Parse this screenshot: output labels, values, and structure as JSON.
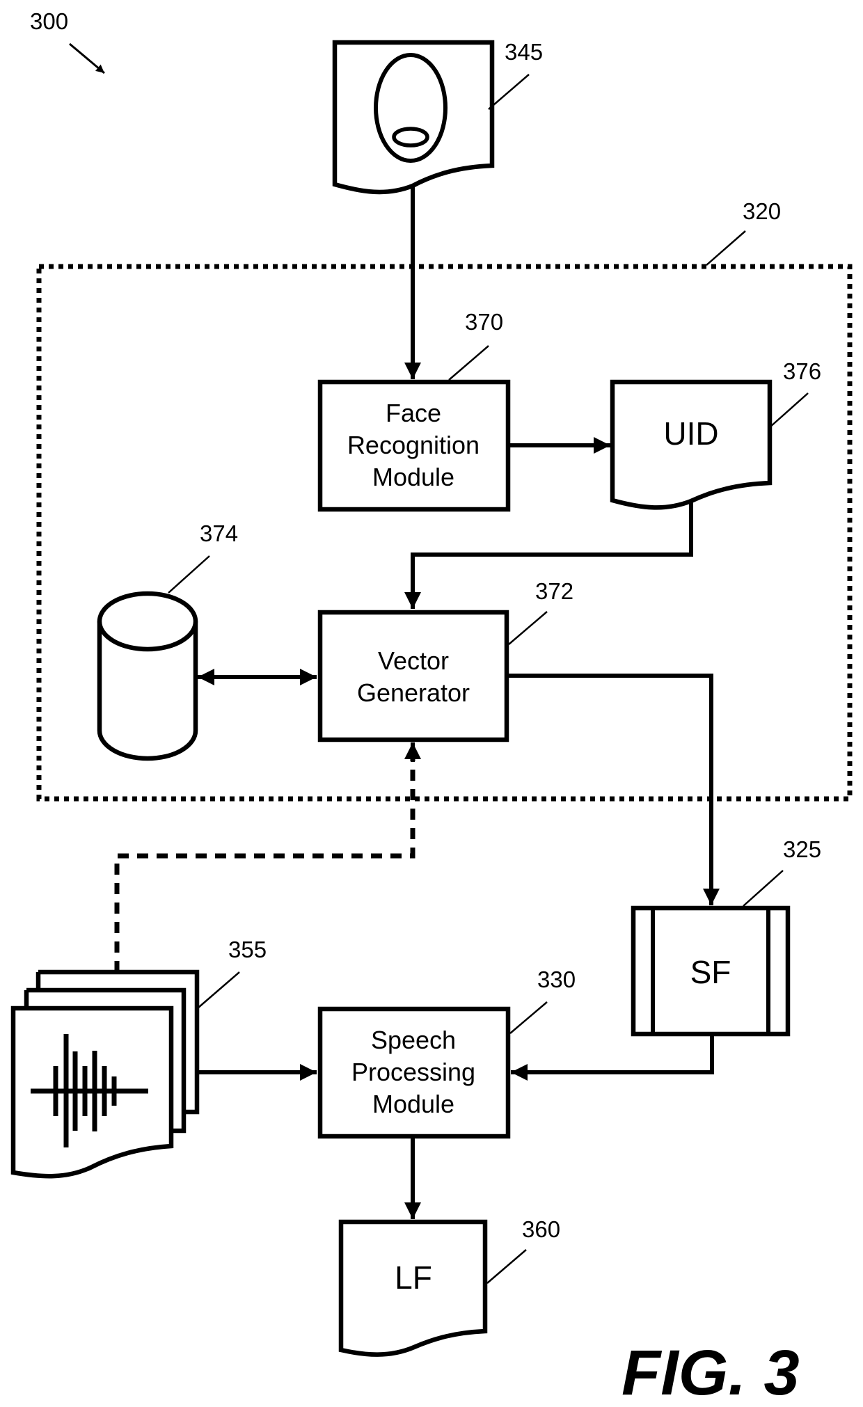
{
  "figure": {
    "number_label": "FIG. 3",
    "system_ref": "300"
  },
  "boundary": {
    "ref": "320",
    "style": "dotted"
  },
  "nodes": {
    "face_image": {
      "ref": "345",
      "kind": "document",
      "icon": "face-icon"
    },
    "face_recognition": {
      "ref": "370",
      "kind": "process",
      "lines": [
        "Face",
        "Recognition",
        "Module"
      ]
    },
    "uid": {
      "ref": "376",
      "kind": "document",
      "label": "UID"
    },
    "database": {
      "ref": "374",
      "kind": "database",
      "icon": "cylinder-icon"
    },
    "vector_generator": {
      "ref": "372",
      "kind": "process",
      "lines": [
        "Vector",
        "Generator"
      ]
    },
    "sf": {
      "ref": "325",
      "kind": "predefined-process",
      "label": "SF"
    },
    "audio_files": {
      "ref": "355",
      "kind": "multi-document",
      "icon": "waveform-icon"
    },
    "speech_processing": {
      "ref": "330",
      "kind": "process",
      "lines": [
        "Speech",
        "Processing",
        "Module"
      ]
    },
    "lf": {
      "ref": "360",
      "kind": "document",
      "label": "LF"
    }
  },
  "edges": [
    {
      "from": "face_image",
      "to": "face_recognition",
      "style": "solid",
      "arrow": "end"
    },
    {
      "from": "face_recognition",
      "to": "uid",
      "style": "solid",
      "arrow": "end"
    },
    {
      "from": "uid",
      "to": "vector_generator",
      "style": "solid",
      "arrow": "end"
    },
    {
      "from": "database",
      "to": "vector_generator",
      "style": "solid",
      "arrow": "both"
    },
    {
      "from": "vector_generator",
      "to": "sf",
      "style": "solid",
      "arrow": "end"
    },
    {
      "from": "audio_files",
      "to": "vector_generator",
      "style": "dashed",
      "arrow": "end"
    },
    {
      "from": "audio_files",
      "to": "speech_processing",
      "style": "solid",
      "arrow": "end"
    },
    {
      "from": "sf",
      "to": "speech_processing",
      "style": "solid",
      "arrow": "end"
    },
    {
      "from": "speech_processing",
      "to": "lf",
      "style": "solid",
      "arrow": "end"
    }
  ]
}
